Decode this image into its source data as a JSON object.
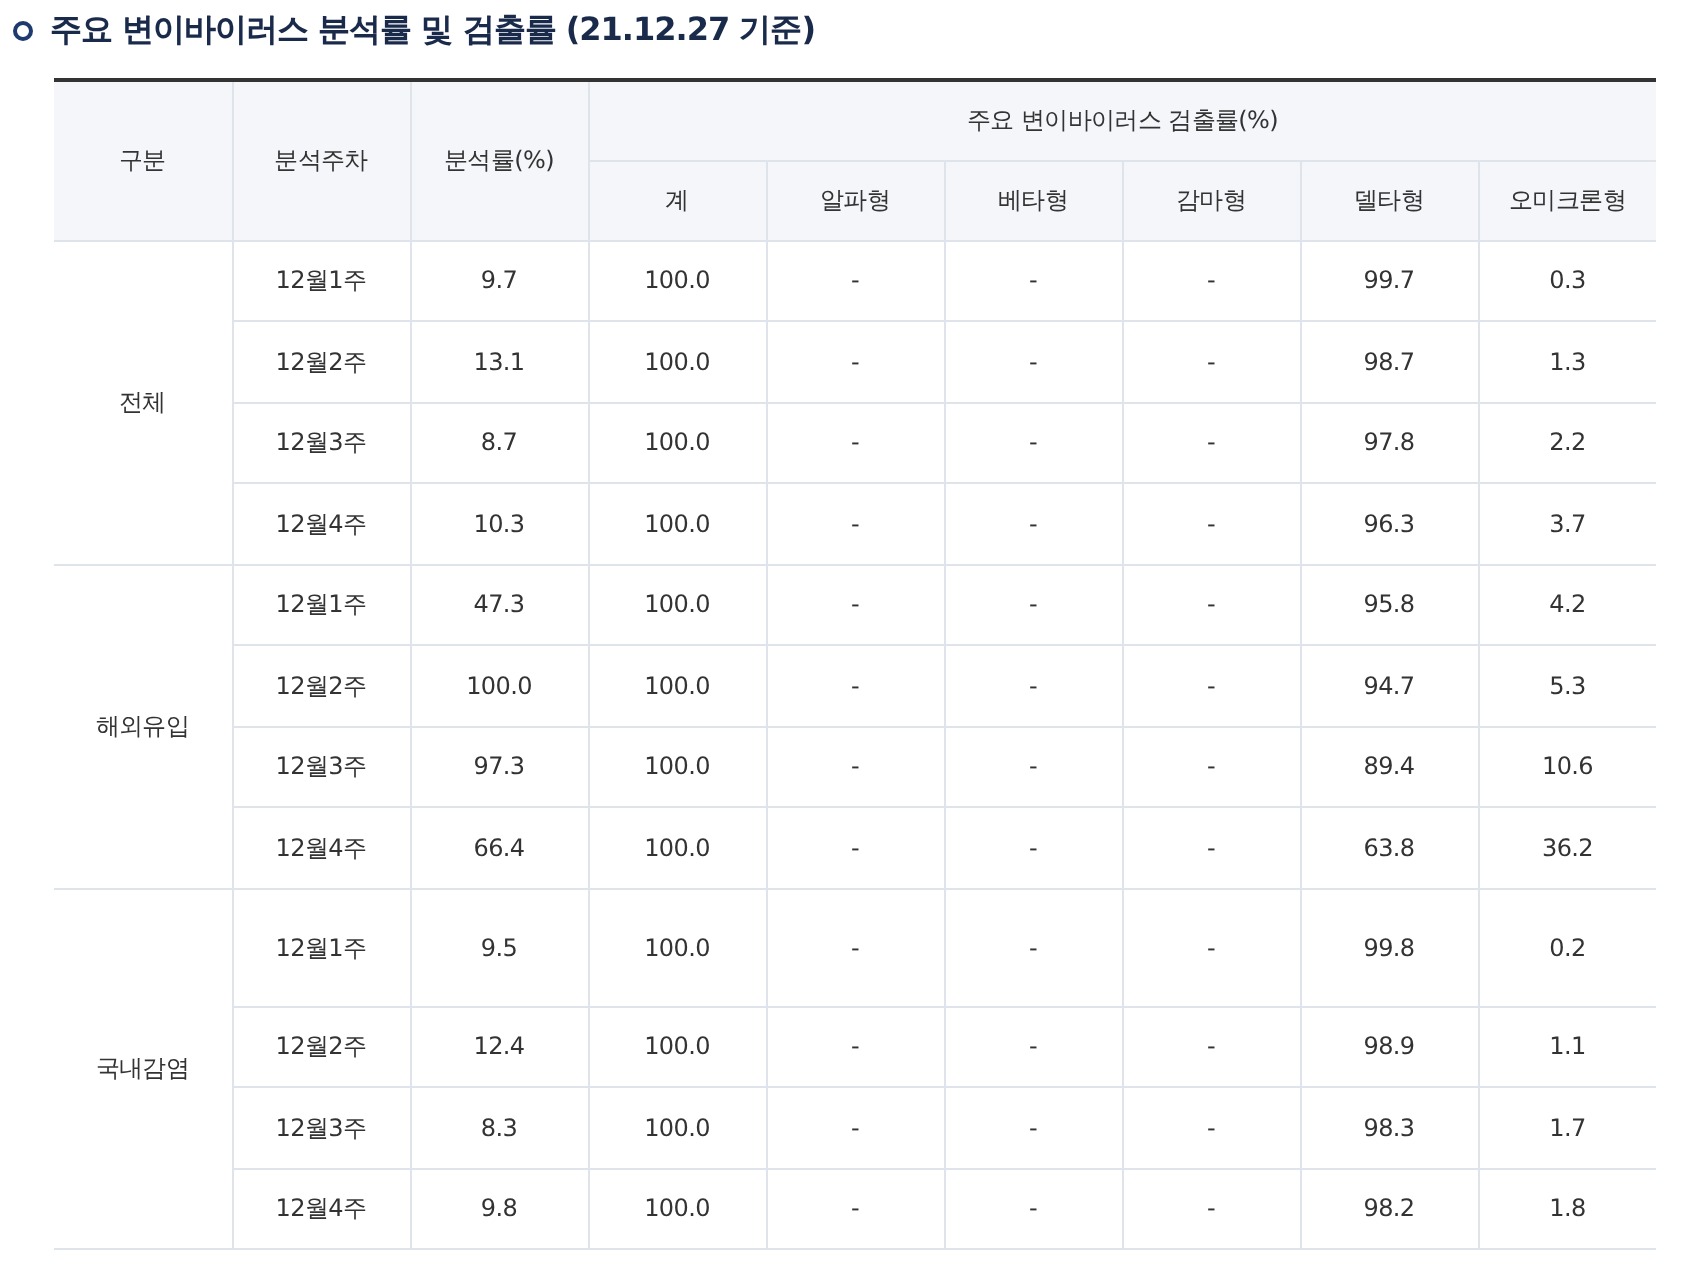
{
  "title": "주요 변이바이러스 분석률 및 검출률 (21.12.27 기준)",
  "table": {
    "header_top": [
      "구분",
      "분석주차",
      "분석률(%)",
      "주요 변이바이러스 검출률(%)"
    ],
    "header_sub": [
      "계",
      "알파형",
      "베타형",
      "감마형",
      "델타형",
      "오미크론형"
    ],
    "groups": [
      {
        "label": "전체",
        "rows": [
          [
            "12월1주",
            "9.7",
            "100.0",
            "-",
            "-",
            "-",
            "99.7",
            "0.3"
          ],
          [
            "12월2주",
            "13.1",
            "100.0",
            "-",
            "-",
            "-",
            "98.7",
            "1.3"
          ],
          [
            "12월3주",
            "8.7",
            "100.0",
            "-",
            "-",
            "-",
            "97.8",
            "2.2"
          ],
          [
            "12월4주",
            "10.3",
            "100.0",
            "-",
            "-",
            "-",
            "96.3",
            "3.7"
          ]
        ]
      },
      {
        "label": "해외유입",
        "rows": [
          [
            "12월1주",
            "47.3",
            "100.0",
            "-",
            "-",
            "-",
            "95.8",
            "4.2"
          ],
          [
            "12월2주",
            "100.0",
            "100.0",
            "-",
            "-",
            "-",
            "94.7",
            "5.3"
          ],
          [
            "12월3주",
            "97.3",
            "100.0",
            "-",
            "-",
            "-",
            "89.4",
            "10.6"
          ],
          [
            "12월4주",
            "66.4",
            "100.0",
            "-",
            "-",
            "-",
            "63.8",
            "36.2"
          ]
        ]
      },
      {
        "label": "국내감염",
        "rows": [
          [
            "12월1주",
            "9.5",
            "100.0",
            "-",
            "-",
            "-",
            "99.8",
            "0.2"
          ],
          [
            "12월2주",
            "12.4",
            "100.0",
            "-",
            "-",
            "-",
            "98.9",
            "1.1"
          ],
          [
            "12월3주",
            "8.3",
            "100.0",
            "-",
            "-",
            "-",
            "98.3",
            "1.7"
          ],
          [
            "12월4주",
            "9.8",
            "100.0",
            "-",
            "-",
            "-",
            "98.2",
            "1.8"
          ]
        ]
      }
    ]
  }
}
